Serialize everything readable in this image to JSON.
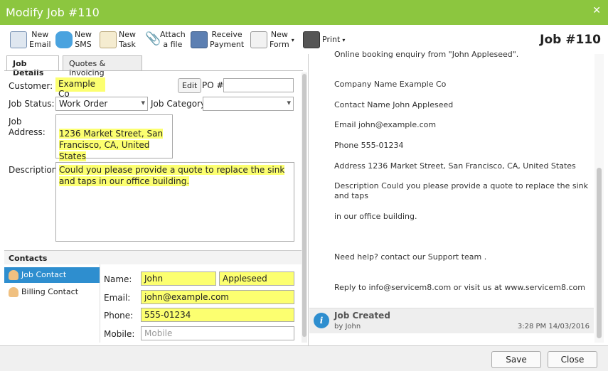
{
  "window": {
    "title": "Modify Job #110",
    "job_number": "Job #110"
  },
  "toolbar": {
    "new_email": "New\nEmail",
    "new_sms": "New\nSMS",
    "new_task": "New\nTask",
    "attach_file": "Attach\na file",
    "receive_payment": "Receive\nPayment",
    "new_form": "New\nForm",
    "print": "Print"
  },
  "tabs": {
    "job_details": "Job Details",
    "quotes_invoicing": "Quotes & Invoicing"
  },
  "job": {
    "customer_label": "Customer:",
    "customer": "Example Co",
    "edit_button": "Edit",
    "po_label": "PO #",
    "po_value": "",
    "status_label": "Job Status:",
    "status": "Work Order",
    "category_label": "Job Category",
    "category": "",
    "address_label": "Job\nAddress:",
    "address": "1236 Market Street, San\nFrancisco, CA, United States",
    "description_label": "Description:",
    "description": "Could you please provide a quote to replace the sink and taps in our office building."
  },
  "contacts": {
    "header": "Contacts",
    "items": [
      {
        "label": "Job Contact"
      },
      {
        "label": "Billing Contact"
      }
    ],
    "name_label": "Name:",
    "first_name": "John",
    "last_name": "Appleseed",
    "email_label": "Email:",
    "email": "john@example.com",
    "phone_label": "Phone:",
    "phone": "555-01234",
    "mobile_label": "Mobile:",
    "mobile_placeholder": "Mobile"
  },
  "email_preview": {
    "lines": [
      "Online booking enquiry from \"John Appleseed\".",
      "Company Name Example Co",
      "Contact Name John Appleseed",
      "Email john@example.com",
      "Phone 555-01234",
      "Address 1236 Market Street, San Francisco, CA, United States",
      "Description Could you please provide a quote to replace the sink and taps",
      "in our office building.",
      "Need help? contact our Support team .",
      "Reply to info@servicem8.com or visit us at www.servicem8.com"
    ]
  },
  "activity": {
    "title": "Job Created",
    "by": "by John",
    "timestamp": "3:28 PM 14/03/2016"
  },
  "footer": {
    "save": "Save",
    "close": "Close"
  },
  "colors": {
    "titlebar": "#8cc63f",
    "highlight": "#fcff70",
    "selected": "#2e8ecf"
  }
}
